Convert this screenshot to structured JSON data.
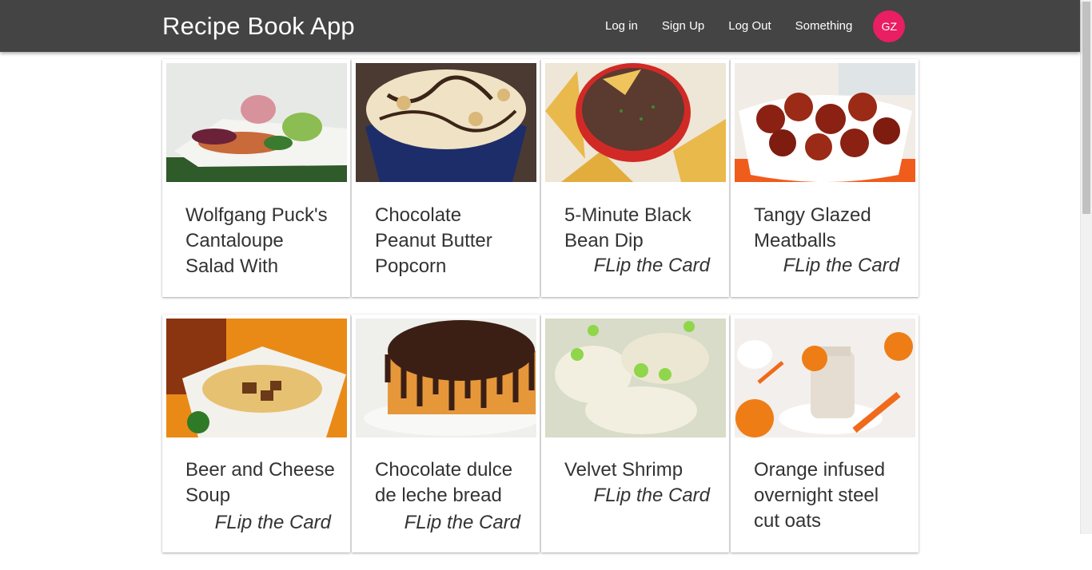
{
  "app": {
    "title": "Recipe Book App"
  },
  "nav": {
    "login": "Log in",
    "signup": "Sign Up",
    "logout": "Log Out",
    "something": "Something",
    "avatar_initials": "GZ"
  },
  "cards": [
    {
      "title": "Wolfgang Puck's Cantaloupe Salad With",
      "flip": ""
    },
    {
      "title": "Chocolate Peanut Butter Popcorn",
      "flip": ""
    },
    {
      "title": "5-Minute Black Bean Dip",
      "flip": "FLip the Card"
    },
    {
      "title": "Tangy Glazed Meatballs",
      "flip": "FLip the Card"
    },
    {
      "title": "Beer and Cheese Soup",
      "flip": "FLip the Card"
    },
    {
      "title": "Chocolate dulce de leche bread",
      "flip": "FLip the Card"
    },
    {
      "title": "Velvet Shrimp",
      "flip": "FLip the Card"
    },
    {
      "title": "Orange infused overnight steel cut oats",
      "flip": ""
    }
  ],
  "colors": {
    "navbar": "#444444",
    "avatar": "#e91e63",
    "text": "#333333"
  }
}
